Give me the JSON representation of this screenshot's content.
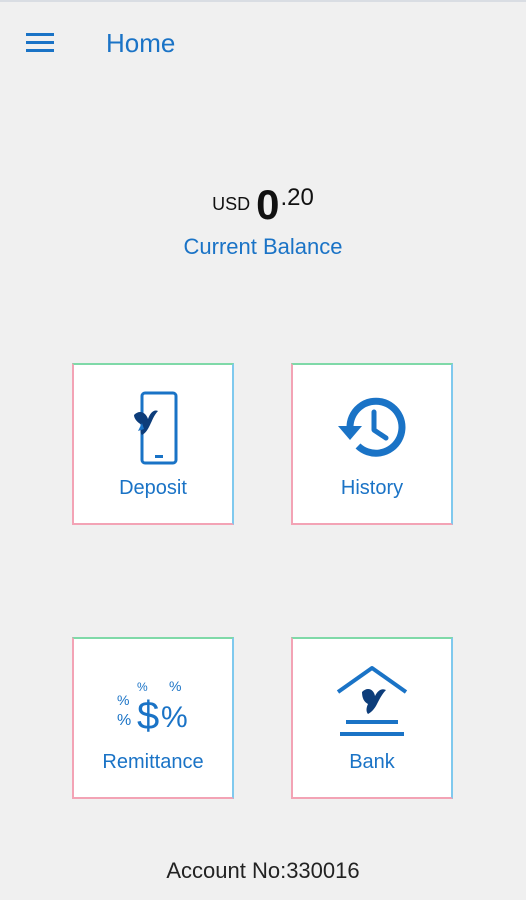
{
  "header": {
    "title": "Home",
    "menu_icon": "hamburger-menu-icon"
  },
  "balance": {
    "currency": "USD",
    "integer": "0",
    "decimal": ".20",
    "label": "Current Balance"
  },
  "tiles": [
    {
      "label": "Deposit",
      "icon": "phone-bird-icon"
    },
    {
      "label": "History",
      "icon": "history-clock-icon"
    },
    {
      "label": "Remittance",
      "icon": "dollar-percent-icon"
    },
    {
      "label": "Bank",
      "icon": "bank-bird-icon"
    }
  ],
  "footer": {
    "account": "Account No:330016"
  },
  "colors": {
    "accent": "#1a73c6",
    "background": "#f0f0f0",
    "tile_border_top": "#7fd9a8",
    "tile_border_left": "#f3a3b5",
    "tile_border_right": "#7fc9ee",
    "tile_border_bottom": "#f3a3b5"
  }
}
